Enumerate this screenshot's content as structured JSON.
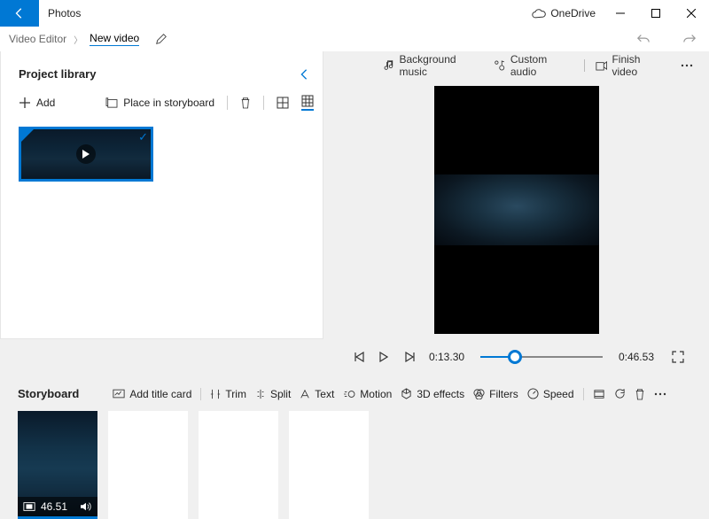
{
  "titlebar": {
    "app": "Photos",
    "onedrive": "OneDrive"
  },
  "breadcrumb": {
    "root": "Video Editor",
    "current": "New video"
  },
  "history": {
    "undo": "undo",
    "redo": "redo"
  },
  "library": {
    "title": "Project library",
    "add": "Add",
    "place": "Place in storyboard"
  },
  "preview_toolbar": {
    "bg_music": "Background music",
    "custom_audio": "Custom audio",
    "finish": "Finish video"
  },
  "playback": {
    "current": "0:13.30",
    "total": "0:46.53",
    "progress_pct": 28
  },
  "storyboard": {
    "title": "Storyboard",
    "add_title_card": "Add title card",
    "trim": "Trim",
    "split": "Split",
    "text": "Text",
    "motion": "Motion",
    "effects3d": "3D effects",
    "filters": "Filters",
    "speed": "Speed",
    "clip_duration": "46.51"
  }
}
